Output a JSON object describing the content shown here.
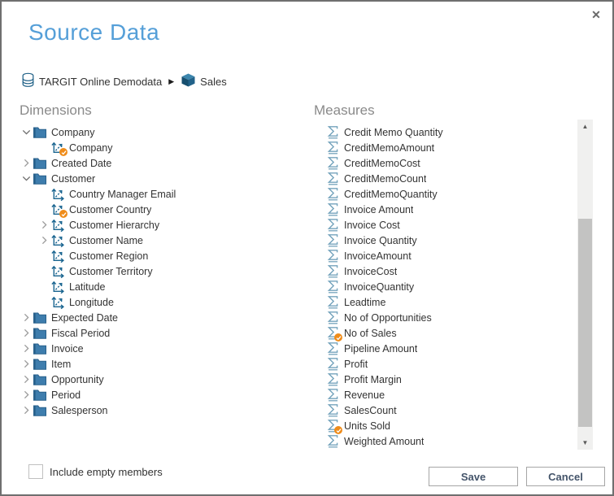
{
  "window": {
    "title": "Source Data"
  },
  "icons": {
    "close": "✕",
    "breadcrumb_separator": "▶",
    "scroll_up": "▲",
    "scroll_down": "▼",
    "folder": "folder-icon",
    "dimension": "axis-icon",
    "measure": "sigma-icon",
    "database": "database-icon",
    "cube": "cube-icon",
    "selected": "orange-check-badge"
  },
  "colors": {
    "title_blue": "#559fd8",
    "header_gray": "#8a8a8a",
    "folder_blue": "#3e7dad",
    "dimension_blue": "#1a6590",
    "sigma_blue": "#74a3bc",
    "badge_orange": "#ef8c1a",
    "text": "#333333",
    "button_text": "#44546a",
    "border_gray": "#6f6f6f"
  },
  "breadcrumb": {
    "database_label": "TARGIT Online Demodata",
    "cube_label": "Sales"
  },
  "dimensions": {
    "header": "Dimensions",
    "tree": [
      {
        "label": "Company",
        "type": "folder",
        "level": 0,
        "expand": "expanded",
        "badge": false
      },
      {
        "label": "Company",
        "type": "dimension",
        "level": 1,
        "expand": null,
        "badge": true
      },
      {
        "label": "Created Date",
        "type": "folder",
        "level": 0,
        "expand": "collapsed",
        "badge": false
      },
      {
        "label": "Customer",
        "type": "folder",
        "level": 0,
        "expand": "expanded",
        "badge": false
      },
      {
        "label": "Country Manager Email",
        "type": "dimension",
        "level": 1,
        "expand": null,
        "badge": false
      },
      {
        "label": "Customer Country",
        "type": "dimension",
        "level": 1,
        "expand": null,
        "badge": true
      },
      {
        "label": "Customer Hierarchy",
        "type": "dimension",
        "level": 1,
        "expand": "collapsed",
        "badge": false
      },
      {
        "label": "Customer Name",
        "type": "dimension",
        "level": 1,
        "expand": "collapsed",
        "badge": false
      },
      {
        "label": "Customer Region",
        "type": "dimension",
        "level": 1,
        "expand": null,
        "badge": false
      },
      {
        "label": "Customer Territory",
        "type": "dimension",
        "level": 1,
        "expand": null,
        "badge": false
      },
      {
        "label": "Latitude",
        "type": "dimension",
        "level": 1,
        "expand": null,
        "badge": false
      },
      {
        "label": "Longitude",
        "type": "dimension",
        "level": 1,
        "expand": null,
        "badge": false
      },
      {
        "label": "Expected Date",
        "type": "folder",
        "level": 0,
        "expand": "collapsed",
        "badge": false
      },
      {
        "label": "Fiscal Period",
        "type": "folder",
        "level": 0,
        "expand": "collapsed",
        "badge": false
      },
      {
        "label": "Invoice",
        "type": "folder",
        "level": 0,
        "expand": "collapsed",
        "badge": false
      },
      {
        "label": "Item",
        "type": "folder",
        "level": 0,
        "expand": "collapsed",
        "badge": false
      },
      {
        "label": "Opportunity",
        "type": "folder",
        "level": 0,
        "expand": "collapsed",
        "badge": false
      },
      {
        "label": "Period",
        "type": "folder",
        "level": 0,
        "expand": "collapsed",
        "badge": false
      },
      {
        "label": "Salesperson",
        "type": "folder",
        "level": 0,
        "expand": "collapsed",
        "badge": false
      }
    ]
  },
  "measures": {
    "header": "Measures",
    "items": [
      {
        "label": "Credit Memo Quantity",
        "badge": false
      },
      {
        "label": "CreditMemoAmount",
        "badge": false
      },
      {
        "label": "CreditMemoCost",
        "badge": false
      },
      {
        "label": "CreditMemoCount",
        "badge": false
      },
      {
        "label": "CreditMemoQuantity",
        "badge": false
      },
      {
        "label": "Invoice Amount",
        "badge": false
      },
      {
        "label": "Invoice Cost",
        "badge": false
      },
      {
        "label": "Invoice Quantity",
        "badge": false
      },
      {
        "label": "InvoiceAmount",
        "badge": false
      },
      {
        "label": "InvoiceCost",
        "badge": false
      },
      {
        "label": "InvoiceQuantity",
        "badge": false
      },
      {
        "label": "Leadtime",
        "badge": false
      },
      {
        "label": "No of Opportunities",
        "badge": false
      },
      {
        "label": "No of Sales",
        "badge": true
      },
      {
        "label": "Pipeline Amount",
        "badge": false
      },
      {
        "label": "Profit",
        "badge": false
      },
      {
        "label": "Profit Margin",
        "badge": false
      },
      {
        "label": "Revenue",
        "badge": false
      },
      {
        "label": "SalesCount",
        "badge": false
      },
      {
        "label": "Units Sold",
        "badge": true
      },
      {
        "label": "Weighted Amount",
        "badge": false
      }
    ]
  },
  "footer": {
    "checkbox_label": "Include empty members",
    "checkbox_checked": false,
    "save_label": "Save",
    "cancel_label": "Cancel"
  }
}
